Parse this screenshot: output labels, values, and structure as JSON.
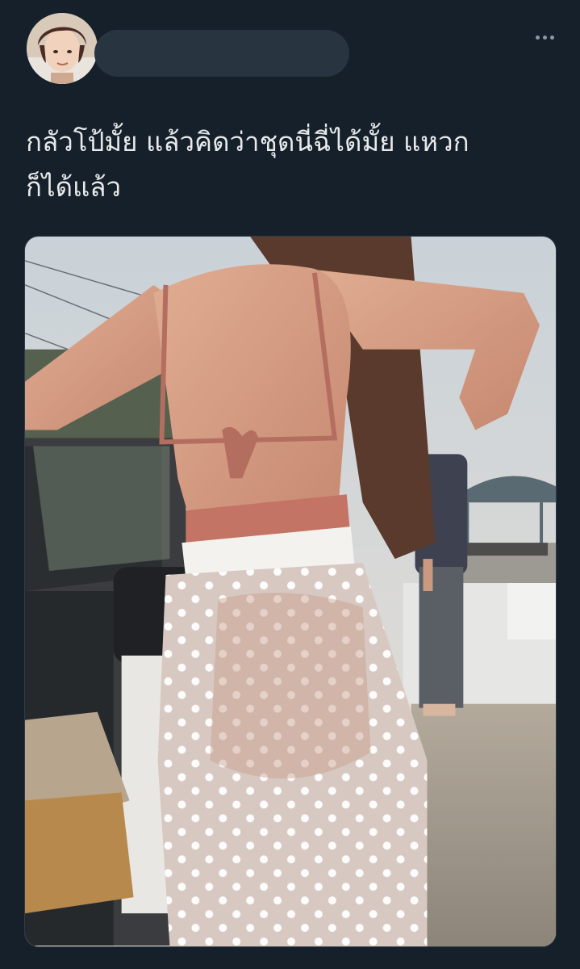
{
  "tweet": {
    "author": {
      "avatar_icon": "user-avatar-photo",
      "name_redacted": true
    },
    "more_icon": "more-horizontal-icon",
    "text_lines": [
      "กลัวโป้มั้ย แล้วคิดว่าชุดนี่ฉี่ได้มั้ย แหวก",
      "ก็ได้แล้ว"
    ],
    "media": {
      "type": "photo",
      "description_icon": "attached-photo"
    }
  },
  "colors": {
    "background": "#15202b",
    "text": "#e7e9ea",
    "muted": "#8b98a5",
    "redaction": "#283440"
  }
}
